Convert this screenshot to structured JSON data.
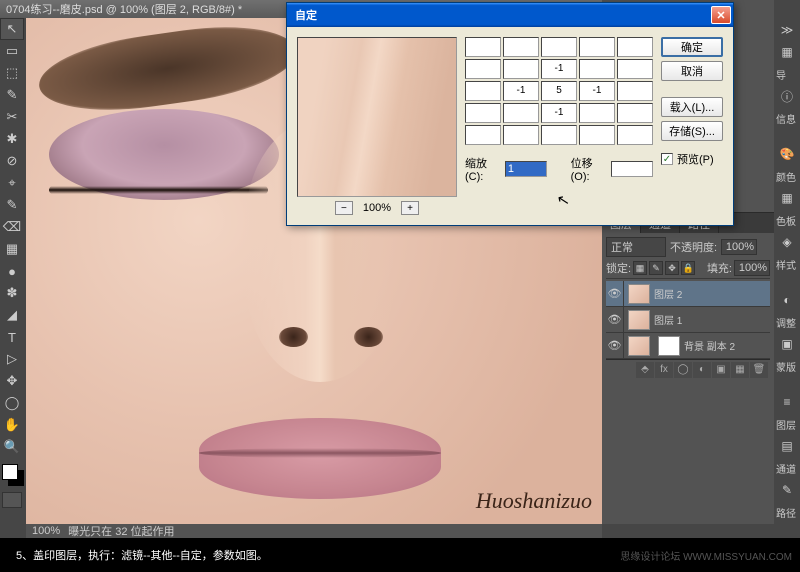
{
  "tab_title": "0704练习--磨皮.psd @ 100% (图层 2, RGB/8#) *",
  "brand": {
    "forum": "思缘设计论坛",
    "url": "WWW.MISSYUAN.COM"
  },
  "status": {
    "zoom": "100%",
    "info": "曝光只在 32 位起作用"
  },
  "instruction": "5、盖印图层，执行：滤镜--其他--自定，参数如图。",
  "wm": "思缘设计论坛 WWW.MISSYUAN.COM",
  "dialog": {
    "title": "自定",
    "preview_zoom": "100%",
    "btn_minus": "−",
    "btn_plus": "+",
    "ok": "确定",
    "cancel": "取消",
    "load": "载入(L)...",
    "save": "存储(S)...",
    "preview_chk": "预览(P)",
    "chk_checked": "✓",
    "scale_lbl": "缩放(C):",
    "scale_val": "1",
    "offset_lbl": "位移(O):",
    "offset_val": "",
    "matrix": [
      [
        "",
        "",
        "",
        "",
        ""
      ],
      [
        "",
        "",
        "-1",
        "",
        ""
      ],
      [
        "",
        "-1",
        "5",
        "-1",
        ""
      ],
      [
        "",
        "",
        "-1",
        "",
        ""
      ],
      [
        "",
        "",
        "",
        "",
        ""
      ]
    ]
  },
  "layers_panel": {
    "tabs": {
      "layers": "图层",
      "channels": "通道",
      "paths": "路径"
    },
    "blend": "正常",
    "opacity_lbl": "不透明度:",
    "opacity": "100%",
    "lock_lbl": "锁定:",
    "fill_lbl": "填充:",
    "fill": "100%",
    "items": [
      {
        "name": "图层 2",
        "sel": true
      },
      {
        "name": "图层 1",
        "sel": false
      },
      {
        "name": "背景 副本 2",
        "sel": false
      }
    ]
  },
  "right_strip": {
    "nav": "导",
    "info": "信息",
    "color": "颜色",
    "swatch": "色板",
    "styles": "样式",
    "adjust": "调整",
    "mask": "蒙版",
    "layers": "图层",
    "channels": "通道",
    "paths": "路径"
  },
  "nav_icon": "▦",
  "chev": "≫",
  "signature": "Huoshanizuo",
  "tools": [
    "↖",
    "▭",
    "⬚",
    "✎",
    "✂",
    "✱",
    "⊘",
    "⌖",
    "✎",
    "⌫",
    "▦",
    "●",
    "✽",
    "◢",
    "T",
    "▷",
    "✥",
    "◯",
    "✋",
    "🔍"
  ]
}
